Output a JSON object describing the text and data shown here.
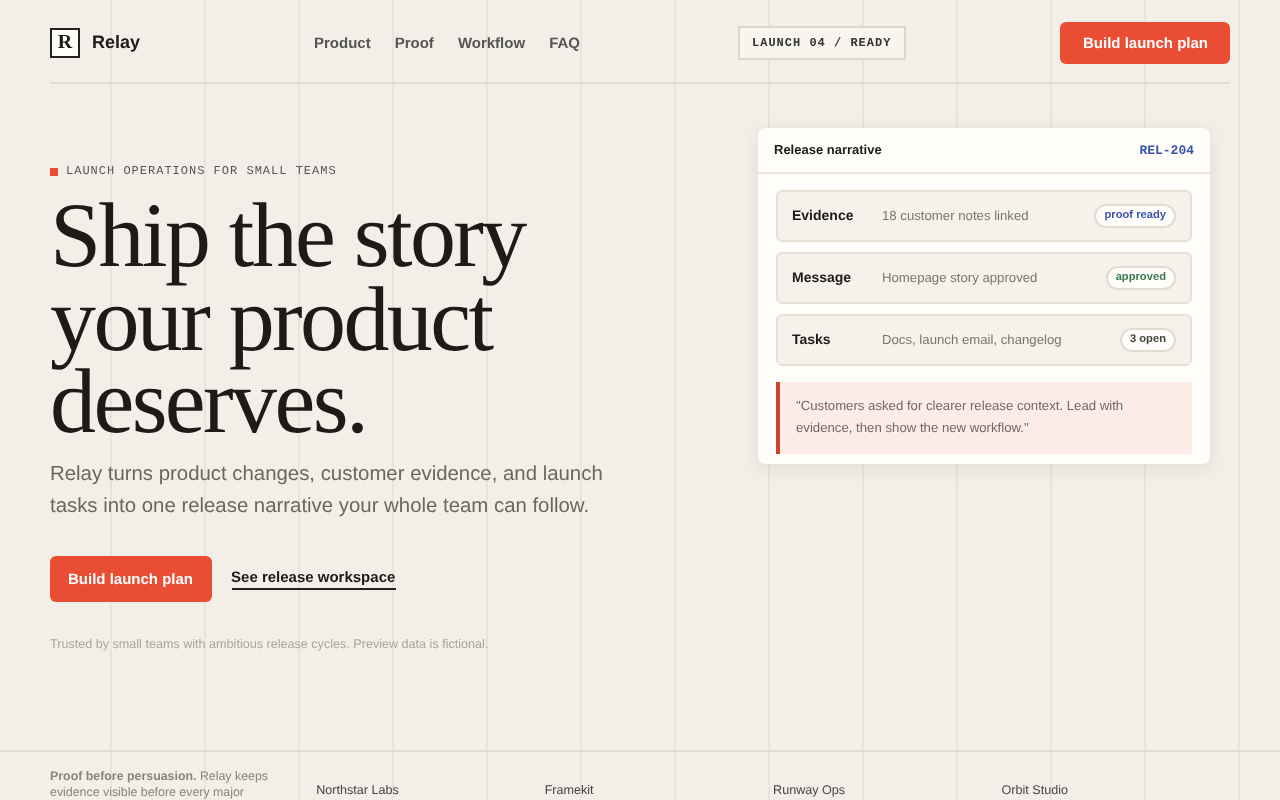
{
  "header": {
    "logo_mark": "R",
    "brand": "Relay",
    "nav": [
      "Product",
      "Proof",
      "Workflow",
      "FAQ"
    ],
    "status_chip": "LAUNCH 04 / READY",
    "cta": "Build launch plan"
  },
  "hero": {
    "eyebrow": "LAUNCH OPERATIONS FOR SMALL TEAMS",
    "headline": [
      "Ship the story",
      "your product",
      "deserves."
    ],
    "intro": "Relay turns product changes, customer evidence, and launch tasks into one release narrative your whole team can follow.",
    "primary_button": "Build launch plan",
    "secondary_link": "See release workspace",
    "footnote": "Trusted by small teams with ambitious release cycles. Preview data is fictional."
  },
  "card": {
    "title": "Release narrative",
    "release_id": "REL-204",
    "rows": [
      {
        "label": "Evidence",
        "detail": "18 customer notes linked",
        "status": "proof ready",
        "kind": "info"
      },
      {
        "label": "Message",
        "detail": "Homepage story approved",
        "status": "approved",
        "kind": "success"
      },
      {
        "label": "Tasks",
        "detail": "Docs, launch email, changelog",
        "status": "3 open",
        "kind": "neutral"
      }
    ],
    "quote": "\"Customers asked for clearer release context. Lead with evidence, then show the new workflow.\""
  },
  "proof": {
    "statement": "**Proof before persuasion.** Relay keeps evidence visible before every major",
    "companies": [
      "Northstar Labs",
      "Framekit",
      "Runway Ops",
      "Orbit Studio"
    ]
  }
}
